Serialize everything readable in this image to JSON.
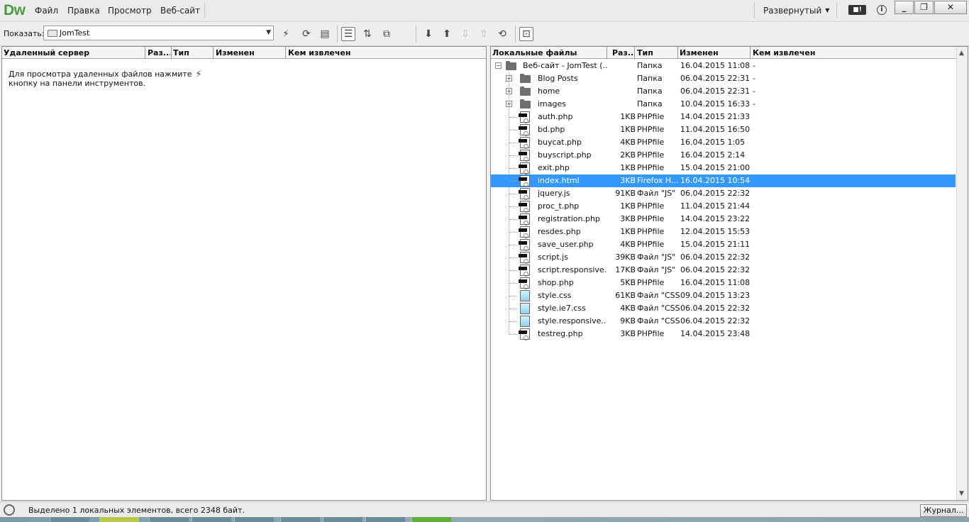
{
  "app": {
    "logo": "Dw",
    "workspace": "Развернутый",
    "gear_label": "■!",
    "info_label": "i"
  },
  "menu": [
    {
      "label": "Файл"
    },
    {
      "label": "Правка"
    },
    {
      "label": "Просмотр"
    },
    {
      "label": "Веб-сайт"
    }
  ],
  "window_buttons": {
    "minimize": "_",
    "restore": "❐",
    "close": "✕"
  },
  "toolbar": {
    "show_label": "Показать:",
    "site": "JomTest"
  },
  "remote": {
    "columns": [
      "Удаленный сервер",
      "Раз...",
      "Тип",
      "Изменен",
      "Кем извлечен"
    ],
    "message": "Для просмотра удаленных файлов нажмите кнопку на панели инструментов."
  },
  "local": {
    "columns": [
      "Локальные файлы",
      "Раз...",
      "Тип",
      "Изменен",
      "Кем извлечен"
    ],
    "root": {
      "name": "Веб-сайт - JomTest (...",
      "size": "",
      "type": "Папка",
      "modified": "16.04.2015 11:08",
      "checked_out": "-"
    },
    "items": [
      {
        "kind": "folder",
        "name": "Blog Posts",
        "size": "",
        "type": "Папка",
        "modified": "06.04.2015 22:31",
        "checked_out": "-"
      },
      {
        "kind": "folder",
        "name": "home",
        "size": "",
        "type": "Папка",
        "modified": "06.04.2015 22:31",
        "checked_out": "-"
      },
      {
        "kind": "folder",
        "name": "images",
        "size": "",
        "type": "Папка",
        "modified": "10.04.2015 16:33",
        "checked_out": "-"
      },
      {
        "kind": "file",
        "name": "auth.php",
        "size": "1KB",
        "type": "PHPfile",
        "modified": "14.04.2015 21:33",
        "checked_out": ""
      },
      {
        "kind": "file",
        "name": "bd.php",
        "size": "1KB",
        "type": "PHPfile",
        "modified": "11.04.2015 16:50",
        "checked_out": ""
      },
      {
        "kind": "file",
        "name": "buycat.php",
        "size": "4KB",
        "type": "PHPfile",
        "modified": "16.04.2015 1:05",
        "checked_out": ""
      },
      {
        "kind": "file",
        "name": "buyscript.php",
        "size": "2KB",
        "type": "PHPfile",
        "modified": "16.04.2015 2:14",
        "checked_out": ""
      },
      {
        "kind": "file",
        "name": "exit.php",
        "size": "1KB",
        "type": "PHPfile",
        "modified": "15.04.2015 21:00",
        "checked_out": ""
      },
      {
        "kind": "file",
        "name": "index.html",
        "size": "3KB",
        "type": "Firefox H...",
        "modified": "16.04.2015 10:54",
        "checked_out": "",
        "selected": true
      },
      {
        "kind": "file",
        "name": "jquery.js",
        "size": "91KB",
        "type": "Файл \"JS\"",
        "modified": "06.04.2015 22:32",
        "checked_out": ""
      },
      {
        "kind": "file",
        "name": "proc_t.php",
        "size": "1KB",
        "type": "PHPfile",
        "modified": "11.04.2015 21:44",
        "checked_out": ""
      },
      {
        "kind": "file",
        "name": "registration.php",
        "size": "3KB",
        "type": "PHPfile",
        "modified": "14.04.2015 23:22",
        "checked_out": ""
      },
      {
        "kind": "file",
        "name": "resdes.php",
        "size": "1KB",
        "type": "PHPfile",
        "modified": "12.04.2015 15:53",
        "checked_out": ""
      },
      {
        "kind": "file",
        "name": "save_user.php",
        "size": "4KB",
        "type": "PHPfile",
        "modified": "15.04.2015 21:11",
        "checked_out": ""
      },
      {
        "kind": "file",
        "name": "script.js",
        "size": "39KB",
        "type": "Файл \"JS\"",
        "modified": "06.04.2015 22:32",
        "checked_out": ""
      },
      {
        "kind": "file",
        "name": "script.responsive.js",
        "size": "17KB",
        "type": "Файл \"JS\"",
        "modified": "06.04.2015 22:32",
        "checked_out": ""
      },
      {
        "kind": "file",
        "name": "shop.php",
        "size": "5KB",
        "type": "PHPfile",
        "modified": "16.04.2015 11:08",
        "checked_out": ""
      },
      {
        "kind": "css",
        "name": "style.css",
        "size": "61KB",
        "type": "Файл \"CSS\"",
        "modified": "09.04.2015 13:23",
        "checked_out": ""
      },
      {
        "kind": "css",
        "name": "style.ie7.css",
        "size": "4KB",
        "type": "Файл \"CSS\"",
        "modified": "06.04.2015 22:32",
        "checked_out": ""
      },
      {
        "kind": "css",
        "name": "style.responsive....",
        "size": "9KB",
        "type": "Файл \"CSS\"",
        "modified": "06.04.2015 22:32",
        "checked_out": ""
      },
      {
        "kind": "file",
        "name": "testreg.php",
        "size": "3KB",
        "type": "PHPfile",
        "modified": "14.04.2015 23:48",
        "checked_out": ""
      }
    ]
  },
  "status": {
    "text": "Выделено 1 локальных элементов, всего 2348 байт.",
    "journal": "Журнал..."
  },
  "colors": {
    "selection": "#3399ff",
    "logo": "#4f9a3f"
  }
}
